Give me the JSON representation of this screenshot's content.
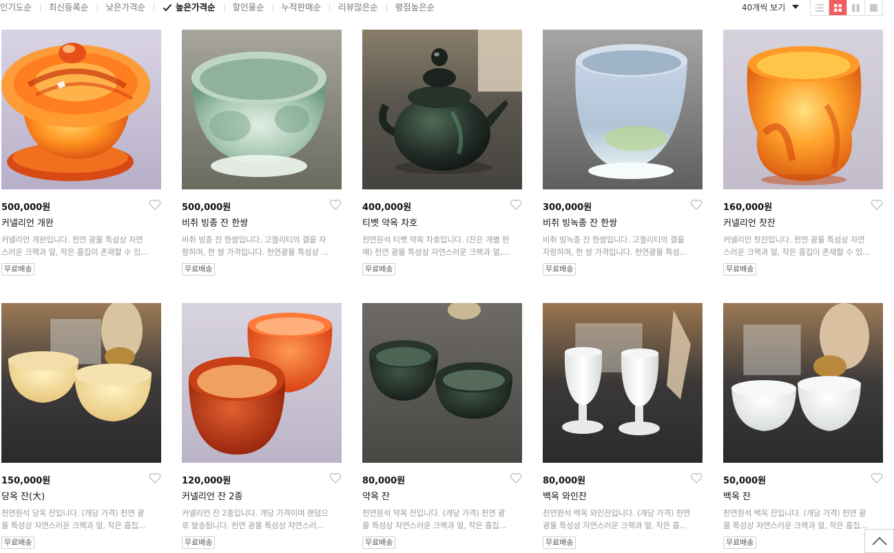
{
  "sort": {
    "items": [
      {
        "label": "인기도순",
        "active": false
      },
      {
        "label": "최신등록순",
        "active": false
      },
      {
        "label": "낮은가격순",
        "active": false
      },
      {
        "label": "높은가격순",
        "active": true
      },
      {
        "label": "할인율순",
        "active": false
      },
      {
        "label": "누적판매순",
        "active": false
      },
      {
        "label": "리뷰많은순",
        "active": false
      },
      {
        "label": "평점높은순",
        "active": false
      }
    ],
    "per_page": "40개씩 보기",
    "view_modes": [
      "list-view-icon",
      "grid-4-view-icon",
      "grid-2-view-icon",
      "large-view-icon"
    ],
    "active_view": 1
  },
  "colors": {
    "accent": "#f25c5c",
    "muted_text": "#999999",
    "border": "#dcdcdc"
  },
  "products": [
    {
      "price": "500,000원",
      "name": "커넬리언 개완",
      "desc_line1": "커넬리언 개완입니다. 천연 광물 특성상 자연",
      "desc_line2": "스러운 크랙과 얼, 작은 흠집이 존재할 수 있...",
      "badge": "무료배송",
      "image": "carnelian-gaiwan"
    },
    {
      "price": "500,000원",
      "name": "비취 빙종 잔 한쌍",
      "desc_line1": "비취 빙종 잔 한쌍입니다. 고퀄리티의 결을 자",
      "desc_line2": "랑하며, 한 쌍 가격입니다. 천연광물 특성상 ...",
      "badge": "무료배송",
      "image": "jade-ice-cup"
    },
    {
      "price": "400,000원",
      "name": "티벳 약옥 차호",
      "desc_line1": "천연원석 티벳 약옥 차호입니다. (잔은 개별 판",
      "desc_line2": "매) 천연 광물 특성상 자연스러운 크랙과 얼,...",
      "badge": "무료배송",
      "image": "tibet-teapot"
    },
    {
      "price": "300,000원",
      "name": "비취 빙녹종 잔 한쌍",
      "desc_line1": "비취 빙녹종 잔 한쌍입니다. 고퀄리티의 결을",
      "desc_line2": "자랑하며, 한 쌍 가격입니다. 천연광물 특성...",
      "badge": "무료배송",
      "image": "jade-green-cup"
    },
    {
      "price": "160,000원",
      "name": "커넬리언 찻잔",
      "desc_line1": "커넬리언 찻잔입니다. 천연 광물 특성상 자연",
      "desc_line2": "스러운 크랙과 얼, 작은 흠집이 존재할 수 있...",
      "badge": "무료배송",
      "image": "carnelian-teacup"
    },
    {
      "price": "150,000원",
      "name": "당옥 잔(大)",
      "desc_line1": "천연원석 당옥 잔입니다. (개당 가격) 천연 광",
      "desc_line2": "물 특성상 자연스러운 크랙과 얼, 작은 흠집...",
      "badge": "무료배송",
      "image": "yellow-jade-cups"
    },
    {
      "price": "120,000원",
      "name": "커넬리언 잔 2종",
      "desc_line1": "커넬리언 잔 2종입니다. 개당 가격이며 랜덤으",
      "desc_line2": "로 발송됩니다. 천연 광물 특성상 자연스러...",
      "badge": "무료배송",
      "image": "carnelian-cups"
    },
    {
      "price": "80,000원",
      "name": "약옥 잔",
      "desc_line1": "천연원석 약옥 잔입니다. (개당 가격) 천연 광",
      "desc_line2": "물 특성상 자연스러운 크랙과 얼, 작은 흠집...",
      "badge": "무료배송",
      "image": "dark-jade-cups"
    },
    {
      "price": "80,000원",
      "name": "백옥 와인잔",
      "desc_line1": "천연원석 백옥 와인잔입니다. (개당 가격) 천연",
      "desc_line2": "광물 특성상 자연스러운 크랙과 얼, 작은 흠...",
      "badge": "무료배송",
      "image": "white-jade-wine-glasses"
    },
    {
      "price": "50,000원",
      "name": "백옥 잔",
      "desc_line1": "천연원석 백옥 잔입니다. (개당 가격) 천연 광",
      "desc_line2": "물 특성상 자연스러운 크랙과 얼, 작은 흠집...",
      "badge": "무료배송",
      "image": "white-jade-cups"
    }
  ]
}
